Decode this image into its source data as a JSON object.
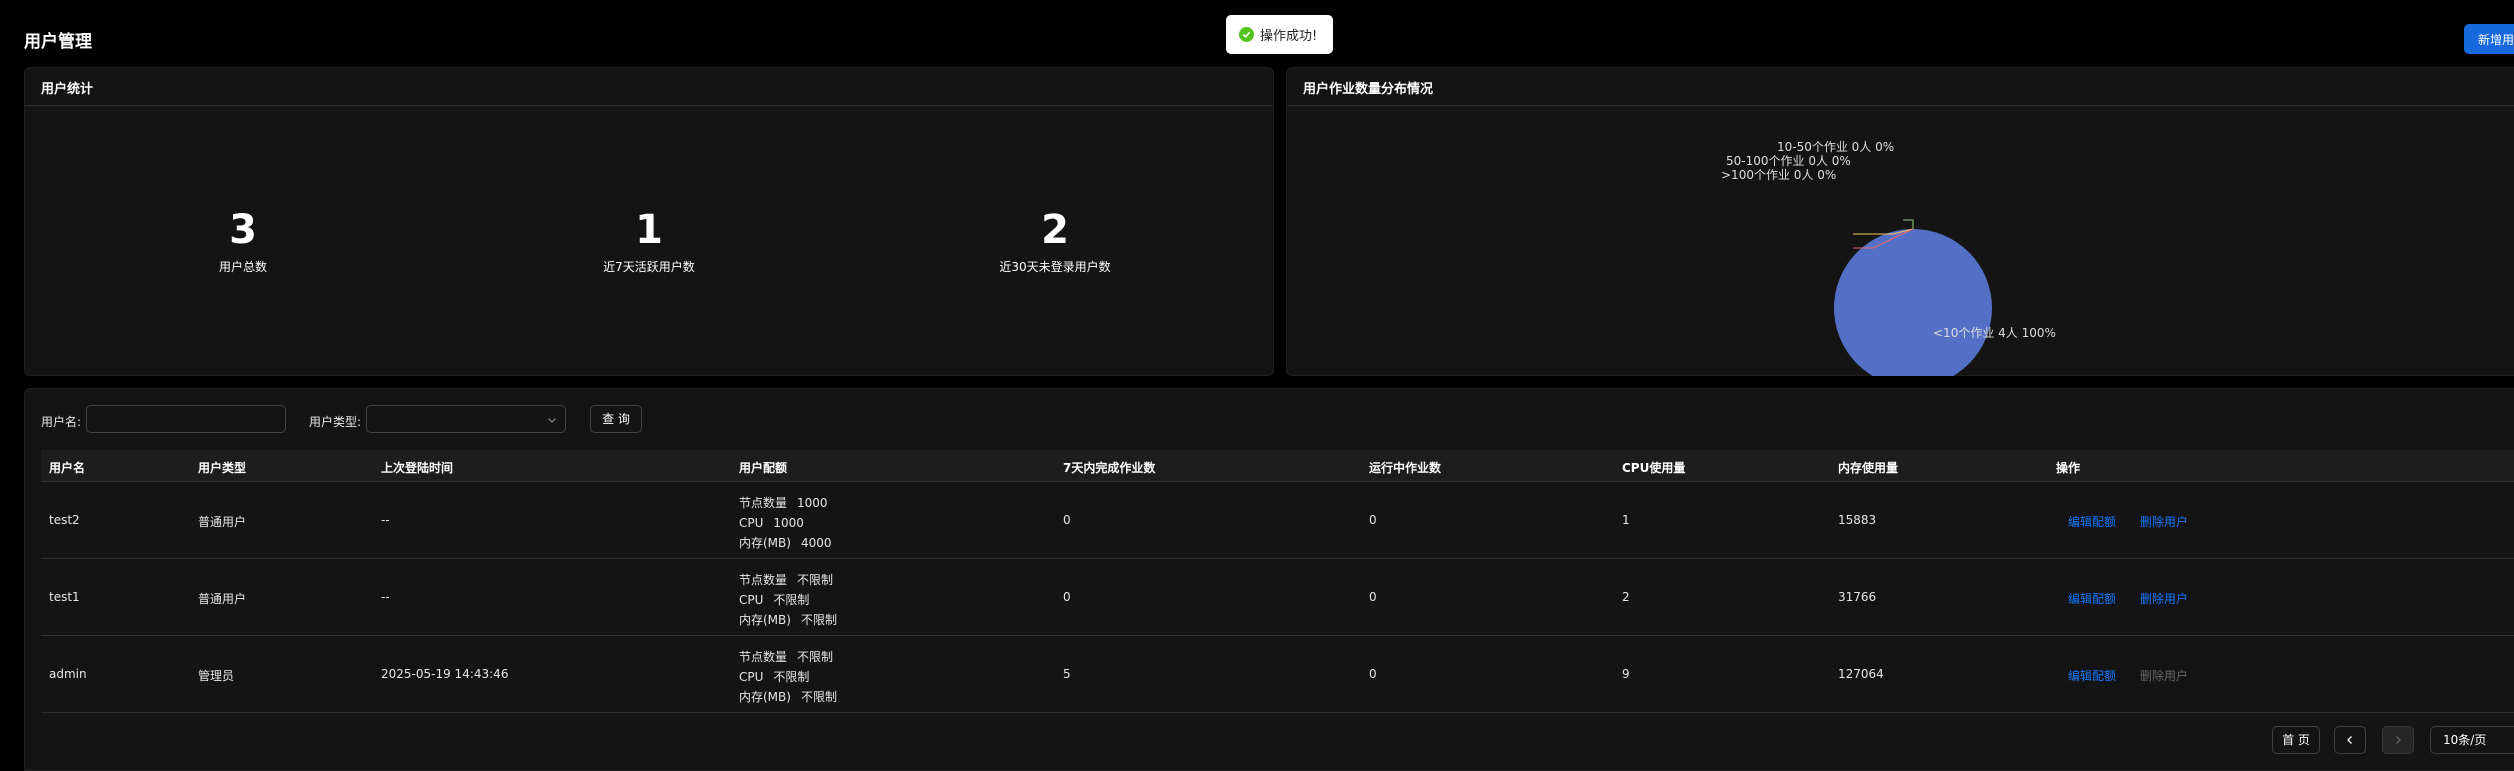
{
  "page": {
    "title": "用户管理",
    "new_button": "新增用户"
  },
  "toast": {
    "text": "操作成功!"
  },
  "stats_card": {
    "title": "用户统计",
    "items": [
      {
        "value": "3",
        "label": "用户总数"
      },
      {
        "value": "1",
        "label": "近7天活跃用户数"
      },
      {
        "value": "2",
        "label": "近30天未登录用户数"
      }
    ]
  },
  "chart_card": {
    "title": "用户作业数量分布情况",
    "chart_data": {
      "type": "pie",
      "categories": [
        "<10个作业",
        "10-50个作业",
        "50-100个作业",
        ">100个作业"
      ],
      "values": [
        4,
        0,
        0,
        0
      ],
      "labels": [
        "<10个作业 4人 100%",
        "10-50个作业 0人 0%",
        "50-100个作业 0人 0%",
        ">100个作业 0人 0%"
      ],
      "colors": [
        "#5470c6",
        "#91cc75",
        "#fac858",
        "#ee6666"
      ]
    }
  },
  "filters": {
    "username_label": "用户名:",
    "username_value": "",
    "usertype_label": "用户类型:",
    "usertype_value": "",
    "query_button": "查 询"
  },
  "table": {
    "headers": [
      "用户名",
      "用户类型",
      "上次登陆时间",
      "用户配额",
      "7天内完成作业数",
      "运行中作业数",
      "CPU使用量",
      "内存使用量",
      "操作"
    ],
    "rows": [
      {
        "username": "test2",
        "type": "普通用户",
        "last_login": "--",
        "quota": [
          [
            "节点数量",
            "1000"
          ],
          [
            "CPU",
            "1000"
          ],
          [
            "内存(MB)",
            "4000"
          ]
        ],
        "done7": "0",
        "running": "0",
        "cpu": "1",
        "mem": "15883",
        "edit": "编辑配额",
        "delete": "删除用户"
      },
      {
        "username": "test1",
        "type": "普通用户",
        "last_login": "--",
        "quota": [
          [
            "节点数量",
            "不限制"
          ],
          [
            "CPU",
            "不限制"
          ],
          [
            "内存(MB)",
            "不限制"
          ]
        ],
        "done7": "0",
        "running": "0",
        "cpu": "2",
        "mem": "31766",
        "edit": "编辑配额",
        "delete": "删除用户"
      },
      {
        "username": "admin",
        "type": "管理员",
        "last_login": "2025-05-19 14:43:46",
        "quota": [
          [
            "节点数量",
            "不限制"
          ],
          [
            "CPU",
            "不限制"
          ],
          [
            "内存(MB)",
            "不限制"
          ]
        ],
        "done7": "5",
        "running": "0",
        "cpu": "9",
        "mem": "127064",
        "edit": "编辑配额",
        "delete": "删除用户"
      }
    ]
  },
  "pagination": {
    "first": "首 页",
    "page_size": "10条/页"
  }
}
